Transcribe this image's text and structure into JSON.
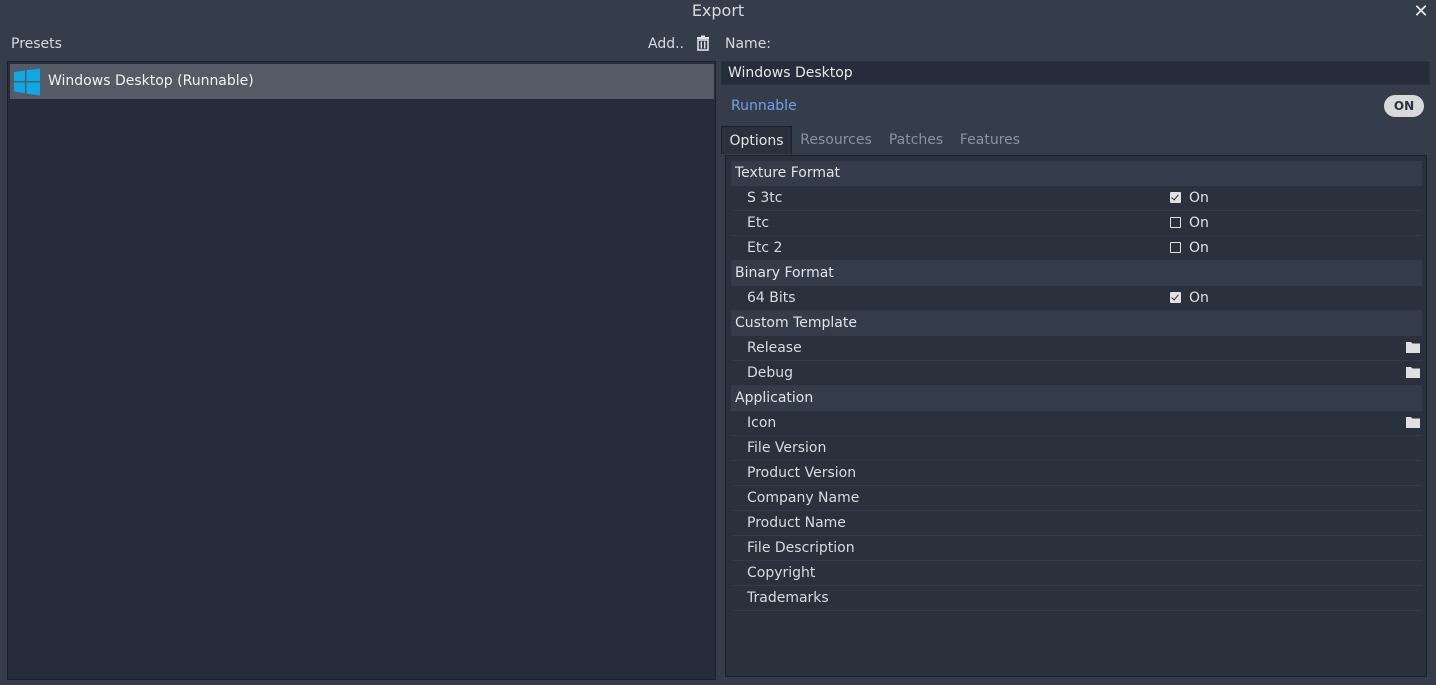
{
  "window": {
    "title": "Export",
    "close_glyph": "✕"
  },
  "presets": {
    "label": "Presets",
    "add_label": "Add..",
    "items": [
      {
        "label": "Windows Desktop (Runnable)",
        "icon": "windows-logo-icon",
        "selected": true
      }
    ]
  },
  "preset_settings": {
    "name_label": "Name:",
    "name_value": "Windows Desktop",
    "runnable_label": "Runnable",
    "runnable_toggle": "ON"
  },
  "tabs": [
    {
      "label": "Options",
      "active": true
    },
    {
      "label": "Resources",
      "active": false
    },
    {
      "label": "Patches",
      "active": false
    },
    {
      "label": "Features",
      "active": false
    }
  ],
  "options": {
    "texture_format": {
      "label": "Texture Format",
      "s3tc": {
        "label": "S 3tc",
        "checked": true,
        "value": "On"
      },
      "etc": {
        "label": "Etc",
        "checked": false,
        "value": "On"
      },
      "etc2": {
        "label": "Etc 2",
        "checked": false,
        "value": "On"
      }
    },
    "binary_format": {
      "label": "Binary Format",
      "bits64": {
        "label": "64 Bits",
        "checked": true,
        "value": "On"
      }
    },
    "custom_template": {
      "label": "Custom Template",
      "release": {
        "label": "Release"
      },
      "debug": {
        "label": "Debug"
      }
    },
    "application": {
      "label": "Application",
      "icon": {
        "label": "Icon"
      },
      "file_version": {
        "label": "File Version"
      },
      "product_version": {
        "label": "Product Version"
      },
      "company_name": {
        "label": "Company Name"
      },
      "product_name": {
        "label": "Product Name"
      },
      "file_description": {
        "label": "File Description"
      },
      "copyright": {
        "label": "Copyright"
      },
      "trademarks": {
        "label": "Trademarks"
      }
    }
  },
  "colors": {
    "background": "#363d4a",
    "panel": "#262c3a",
    "selection": "#555b66",
    "accent_blue": "#6ea1ec",
    "windows_logo": "#0ea8e6"
  }
}
